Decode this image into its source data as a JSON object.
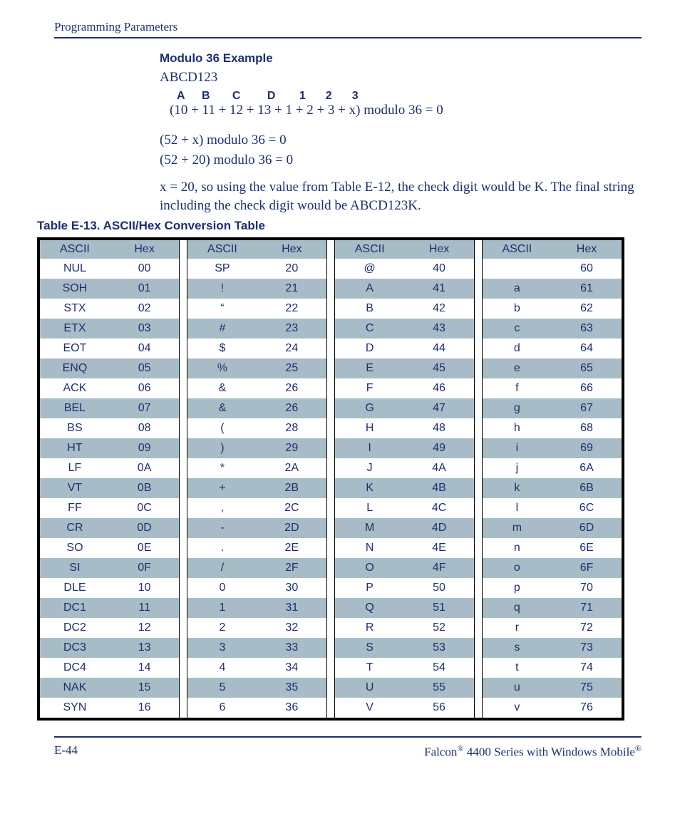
{
  "header": {
    "title": "Programming Parameters"
  },
  "section": {
    "heading": "Modulo 36 Example",
    "sample_string": "ABCD123",
    "letters": [
      "A",
      "B",
      "C",
      "D",
      "1",
      "2",
      "3"
    ],
    "equation_main": "(10 + 11 + 12 + 13 + 1 + 2 + 3 + x) modulo 36 = 0",
    "equation_2": "(52 + x) modulo 36 = 0",
    "equation_3": "(52 + 20) modulo 36 = 0",
    "para_before_link": "x = 20, so using the value from ",
    "link_text": "Table E-12",
    "para_after_link": ", the check digit would be K. The final string including the check digit would be ABCD123K."
  },
  "table": {
    "caption": "Table E-13. ASCII/Hex Conversion Table",
    "headers": [
      "ASCII",
      "Hex",
      "ASCII",
      "Hex",
      "ASCII",
      "Hex",
      "ASCII",
      "Hex"
    ],
    "rows": [
      [
        "NUL",
        "00",
        "SP",
        "20",
        "@",
        "40",
        "",
        "60"
      ],
      [
        "SOH",
        "01",
        "!",
        "21",
        "A",
        "41",
        "a",
        "61"
      ],
      [
        "STX",
        "02",
        "“",
        "22",
        "B",
        "42",
        "b",
        "62"
      ],
      [
        "ETX",
        "03",
        "#",
        "23",
        "C",
        "43",
        "c",
        "63"
      ],
      [
        "EOT",
        "04",
        "$",
        "24",
        "D",
        "44",
        "d",
        "64"
      ],
      [
        "ENQ",
        "05",
        "%",
        "25",
        "E",
        "45",
        "e",
        "65"
      ],
      [
        "ACK",
        "06",
        "&",
        "26",
        "F",
        "46",
        "f",
        "66"
      ],
      [
        "BEL",
        "07",
        "&",
        "26",
        "G",
        "47",
        "g",
        "67"
      ],
      [
        "BS",
        "08",
        "(",
        "28",
        "H",
        "48",
        "h",
        "68"
      ],
      [
        "HT",
        "09",
        ")",
        "29",
        "I",
        "49",
        "i",
        "69"
      ],
      [
        "LF",
        "0A",
        "*",
        "2A",
        "J",
        "4A",
        "j",
        "6A"
      ],
      [
        "VT",
        "0B",
        "+",
        "2B",
        "K",
        "4B",
        "k",
        "6B"
      ],
      [
        "FF",
        "0C",
        ",",
        "2C",
        "L",
        "4C",
        "l",
        "6C"
      ],
      [
        "CR",
        "0D",
        "-",
        "2D",
        "M",
        "4D",
        "m",
        "6D"
      ],
      [
        "SO",
        "0E",
        ".",
        "2E",
        "N",
        "4E",
        "n",
        "6E"
      ],
      [
        "SI",
        "0F",
        "/",
        "2F",
        "O",
        "4F",
        "o",
        "6F"
      ],
      [
        "DLE",
        "10",
        "0",
        "30",
        "P",
        "50",
        "p",
        "70"
      ],
      [
        "DC1",
        "11",
        "1",
        "31",
        "Q",
        "51",
        "q",
        "71"
      ],
      [
        "DC2",
        "12",
        "2",
        "32",
        "R",
        "52",
        "r",
        "72"
      ],
      [
        "DC3",
        "13",
        "3",
        "33",
        "S",
        "53",
        "s",
        "73"
      ],
      [
        "DC4",
        "14",
        "4",
        "34",
        "T",
        "54",
        "t",
        "74"
      ],
      [
        "NAK",
        "15",
        "5",
        "35",
        "U",
        "55",
        "u",
        "75"
      ],
      [
        "SYN",
        "16",
        "6",
        "36",
        "V",
        "56",
        "v",
        "76"
      ]
    ]
  },
  "footer": {
    "page_num": "E-44",
    "product_a": "Falcon",
    "product_mid": " 4400 Series with Windows Mobile",
    "reg": "®"
  }
}
